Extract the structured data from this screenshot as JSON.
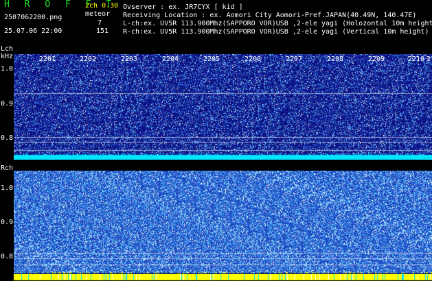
{
  "header": {
    "app_title": "H R O F F T",
    "version": "2ch 0.30",
    "meteor_label": "meteor",
    "lch_count": "7",
    "rch_count": "151",
    "filename": "2507062200.png",
    "datetime": "25.07.06 22:00",
    "info_lines": [
      "Ovserver              : ex. JR7CYX [ kid ]",
      "Receiving Location : ex. Aomori City Aomori-Pref.JAPAN(40.49N, 140.47E)",
      "L-ch:ex. UV5R 113.900Mhz(SAPPORO VOR)USB ,2-ele yagi (Holozontal 10m height)",
      "R-ch:ex. UV5R 113.900Mhz(SAPPORO VOR)USB ,2-ele yagi (Vertical 10m height)"
    ]
  },
  "lch": {
    "label": "Lch",
    "unit": "kHz",
    "y_ticks": [
      "1.0",
      "0.9",
      "0.8"
    ],
    "time_ticks": [
      "2201",
      "2202",
      "2203",
      "2204",
      "2205",
      "2206",
      "2207",
      "2208",
      "2209",
      "2210",
      "2"
    ]
  },
  "rch": {
    "label": "Rch",
    "y_ticks": [
      "1.0",
      "0.9",
      "0.8"
    ]
  },
  "colors": {
    "title": "#1fe31f",
    "version": "#ffff00",
    "lch_background": "#0b1080",
    "rch_background": "#1a48b8",
    "baseline_cyan": "#00e5ff",
    "baseline_yellow": "#ffff00"
  }
}
